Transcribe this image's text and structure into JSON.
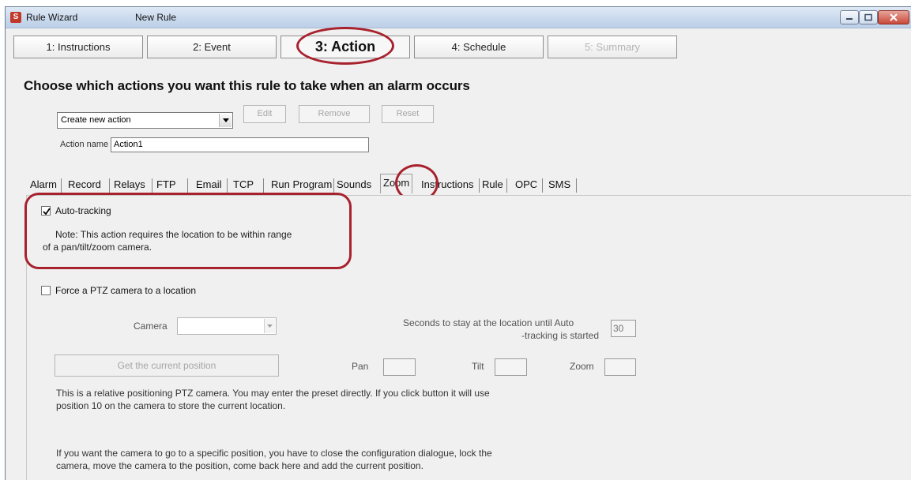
{
  "window": {
    "app_icon_letter": "S",
    "app_title": "Rule Wizard",
    "doc_title": "New Rule"
  },
  "steps": [
    {
      "label": "1: Instructions",
      "state": "normal"
    },
    {
      "label": "2: Event",
      "state": "normal"
    },
    {
      "label": "3: Action",
      "state": "active"
    },
    {
      "label": "4: Schedule",
      "state": "normal"
    },
    {
      "label": "5: Summary",
      "state": "disabled"
    }
  ],
  "heading": "Choose which actions you want this rule to take when an alarm occurs",
  "action_select": {
    "value": "Create new action"
  },
  "buttons": {
    "edit": "Edit",
    "remove": "Remove",
    "reset": "Reset"
  },
  "action_name": {
    "label": "Action name",
    "value": "Action1"
  },
  "tabs": [
    "Alarm",
    "Record",
    "Relays",
    "FTP",
    "Email",
    "TCP",
    "Run Program",
    "Sounds",
    "Zoom",
    "Instructions",
    "Rule",
    "OPC",
    "SMS"
  ],
  "active_tab": "Zoom",
  "zoom_panel": {
    "auto_tracking": {
      "label": "Auto-tracking",
      "checked": true
    },
    "note_line1": "Note: This action requires the location to be within range",
    "note_line2": "of a pan/tilt/zoom camera.",
    "force_ptz": {
      "label": "Force a PTZ camera to a location",
      "checked": false
    },
    "camera_label": "Camera",
    "seconds_line1": "Seconds to stay at the location until Auto",
    "seconds_line2": "-tracking is started",
    "seconds_value": "30",
    "get_position_button": "Get the current position",
    "pan_label": "Pan",
    "tilt_label": "Tilt",
    "zoom_label": "Zoom",
    "info1_line1": "This is a relative positioning PTZ camera.  You may enter the preset directly.  If you click button it will use",
    "info1_line2": "position 10 on the camera to store the current location.",
    "info2_line1": "If you want the camera to go to a specific position, you have to close the configuration dialogue, lock the",
    "info2_line2": "camera, move the camera to the position, come back here and add the current position."
  },
  "colors": {
    "annotation_red": "#a8222e",
    "titlebar": "#c8d8ec",
    "dialog_bg": "#f0f0f0"
  }
}
